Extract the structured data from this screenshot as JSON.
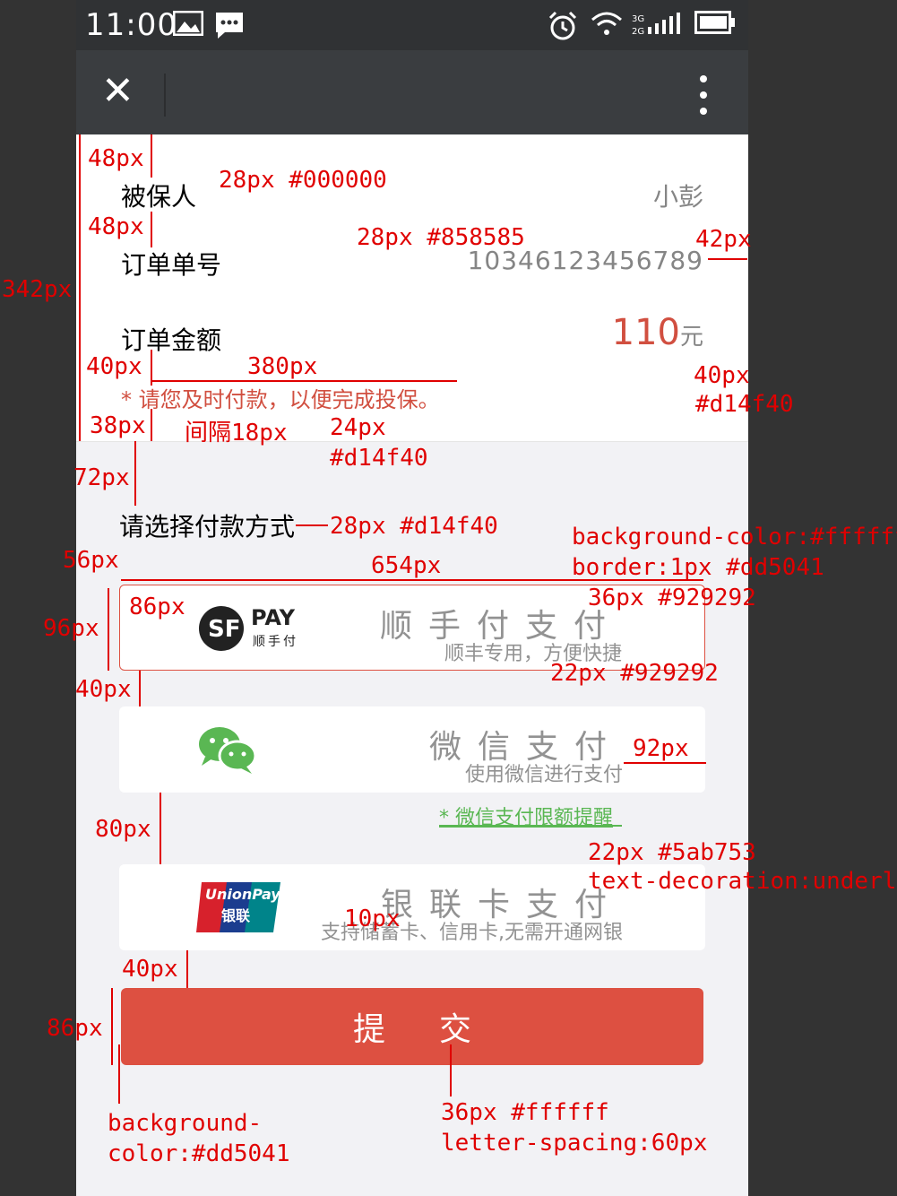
{
  "status_bar": {
    "time": "11:00"
  },
  "nav": {
    "close_glyph": "✕"
  },
  "order": {
    "insured_label": "被保人",
    "insured_value": "小彭",
    "order_no_label": "订单单号",
    "order_no_value": "10346123456789",
    "amount_label": "订单金额",
    "amount_value": "110",
    "amount_unit": "元",
    "notice": "* 请您及时付款，以便完成投保。"
  },
  "payment": {
    "section_title": "请选择付款方式",
    "methods": [
      {
        "logo_top": "PAY",
        "logo_bottom": "顺手付",
        "title": "顺手付支付",
        "subtitle": "顺丰专用，方便快捷",
        "active": true
      },
      {
        "title": "微信支付",
        "subtitle": "使用微信进行支付",
        "active": false
      },
      {
        "logo_top": "UnionPay",
        "logo_bottom": "银联",
        "title": "银联卡支付",
        "subtitle": "支持储蓄卡、信用卡,无需开通网银",
        "active": false
      }
    ],
    "wechat_limit_link": "* 微信支付限额提醒"
  },
  "submit_label": "提交",
  "annotations": {
    "a_48px_1": "48px",
    "a_28px_000": "28px #000000",
    "a_48px_2": "48px",
    "a_28px_858585": "28px #858585",
    "a_42px": "42px",
    "a_342px": "342px",
    "a_40px_1": "40px",
    "a_380px": "380px",
    "a_40px_2": "40px",
    "a_d14f40_1": "#d14f40",
    "a_38px": "38px",
    "a_gap18": "间隔18px",
    "a_24px": "24px",
    "a_d14f40_2": "#d14f40",
    "a_72px": "72px",
    "a_28px_d14f40": "28px #d14f40",
    "a_bg_fff": "background-color:#ffffff",
    "a_border": "border:1px #dd5041",
    "a_56px": "56px",
    "a_654px": "654px",
    "a_86px": "86px",
    "a_36px_929292": "36px #929292",
    "a_96px": "96px",
    "a_22px_929292": "22px #929292",
    "a_40px_3": "40px",
    "a_92px": "92px",
    "a_80px": "80px",
    "a_22px_5ab753": "22px #5ab753",
    "a_underline": "text-decoration:underline",
    "a_10px": "10px",
    "a_40px_4": "40px",
    "a_86px_2": "86px",
    "a_bg_dd5041_1": "background-",
    "a_bg_dd5041_2": "color:#dd5041",
    "a_36px_fff": "36px #ffffff",
    "a_letter_spacing": "letter-spacing:60px"
  },
  "colors": {
    "accent": "#dd5041",
    "text_red": "#d14f40",
    "grey": "#929292",
    "green": "#5ab753"
  }
}
